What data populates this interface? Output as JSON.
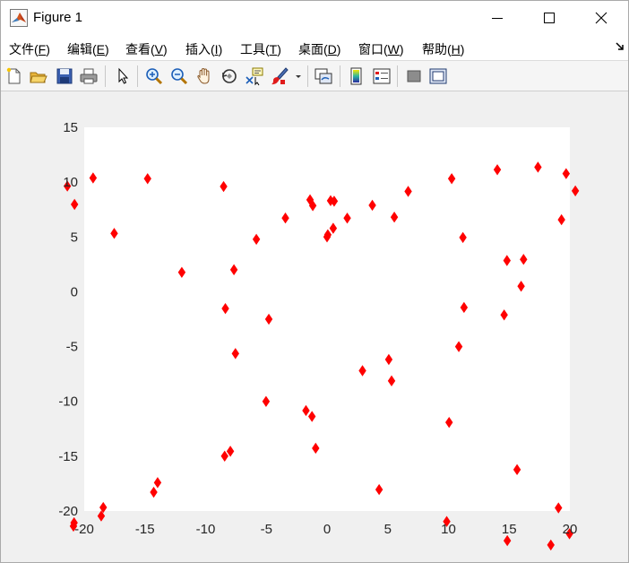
{
  "window": {
    "title": "Figure 1"
  },
  "menu": {
    "items": [
      {
        "label": "文件(",
        "key": "F",
        "tail": ")"
      },
      {
        "label": "编辑(",
        "key": "E",
        "tail": ")"
      },
      {
        "label": "查看(",
        "key": "V",
        "tail": ")"
      },
      {
        "label": "插入(",
        "key": "I",
        "tail": ")"
      },
      {
        "label": "工具(",
        "key": "T",
        "tail": ")"
      },
      {
        "label": "桌面(",
        "key": "D",
        "tail": ")"
      },
      {
        "label": "窗口(",
        "key": "W",
        "tail": ")"
      },
      {
        "label": "帮助(",
        "key": "H",
        "tail": ")"
      }
    ]
  },
  "toolbar": {
    "icons": [
      "new-figure-icon",
      "open-file-icon",
      "save-icon",
      "print-icon",
      "edit-plot-arrow-icon",
      "zoom-in-icon",
      "zoom-out-icon",
      "pan-hand-icon",
      "rotate-3d-icon",
      "data-cursor-icon",
      "brush-icon",
      "brush-dropdown-icon",
      "link-plot-icon",
      "insert-colorbar-icon",
      "insert-legend-icon",
      "hide-plot-tools-icon",
      "show-plot-tools-icon"
    ]
  },
  "colors": {
    "marker": "#ff0000",
    "axes_bg": "#ffffff",
    "figure_bg": "#f0f0f0"
  },
  "chart_data": {
    "type": "scatter",
    "marker": "diamond",
    "color": "#ff0000",
    "xlim": [
      -20,
      20
    ],
    "ylim": [
      -20,
      15
    ],
    "xticks": [
      "-20",
      "-15",
      "-10",
      "-5",
      "0",
      "5",
      "10",
      "15",
      "20"
    ],
    "yticks": [
      "15",
      "10",
      "5",
      "0",
      "-5",
      "-10",
      "-15",
      "-20"
    ],
    "grid": false,
    "x": [
      0.0,
      0.064,
      0.508,
      1.663,
      3.73,
      6.682,
      10.267,
      14.025,
      17.373,
      19.693,
      20.452,
      19.311,
      16.185,
      11.282,
      5.086,
      -1.736,
      -8.433,
      -14.277,
      -18.6,
      -20.887,
      -20.836,
      -18.433,
      -13.954,
      -7.963,
      -1.241,
      5.315,
      10.853,
      14.588,
      15.986,
      14.82,
      11.191,
      5.541,
      -1.4,
      -8.521,
      -14.78,
      -19.271,
      -21.391,
      -20.798,
      -17.53,
      -11.963,
      -4.795,
      2.918,
      10.053,
      15.651,
      19.06,
      19.968,
      18.433,
      14.846,
      9.857,
      4.29,
      -0.938,
      -5.024,
      -7.545,
      -8.374,
      -7.668,
      -5.822,
      -3.43,
      -1.175,
      0.293,
      0.585
    ],
    "y": [
      5.0,
      5.2,
      5.789,
      6.716,
      7.887,
      9.154,
      10.315,
      11.134,
      11.363,
      10.775,
      9.2,
      6.568,
      2.95,
      -1.435,
      -6.179,
      -10.839,
      -14.995,
      -18.286,
      -20.455,
      -21.379,
      -21.074,
      -19.678,
      -17.412,
      -14.551,
      -11.375,
      -8.13,
      -5.006,
      -2.116,
      0.502,
      2.847,
      4.947,
      6.806,
      8.387,
      9.601,
      10.317,
      10.38,
      9.638,
      7.968,
      5.321,
      1.77,
      -2.505,
      -7.202,
      -11.919,
      -16.225,
      -19.717,
      -22.077,
      -23.1,
      -22.707,
      -20.959,
      -18.046,
      -14.272,
      -10.007,
      -5.639,
      -1.534,
      2.008,
      4.787,
      6.724,
      7.853,
      8.307,
      8.262
    ]
  }
}
